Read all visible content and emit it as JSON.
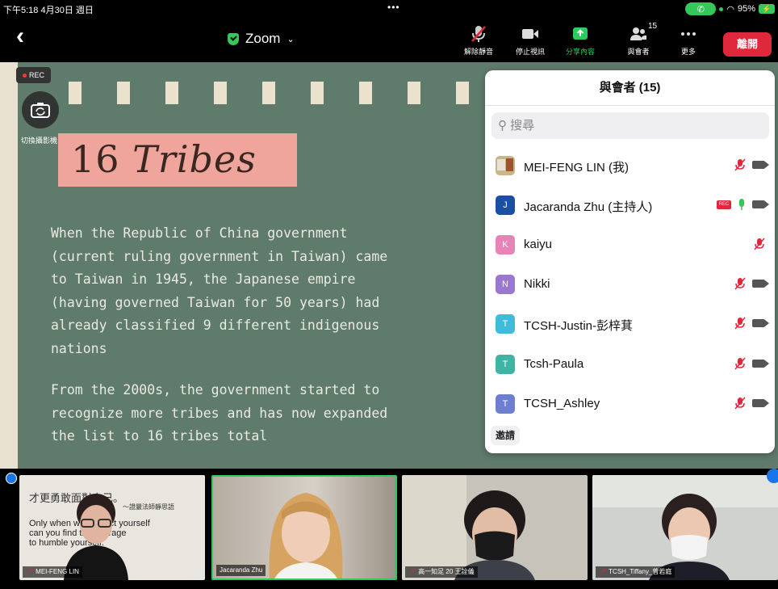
{
  "status_bar": {
    "time": "下午5:18  4月30日 週日",
    "dots": "•••",
    "battery": "95%"
  },
  "toolbar": {
    "title": "Zoom",
    "buttons": [
      {
        "label": "解除靜音",
        "icon": "muted-mic-icon"
      },
      {
        "label": "停止視訊",
        "icon": "video-camera-icon"
      },
      {
        "label": "分享內容",
        "icon": "share-screen-icon"
      },
      {
        "label": "與會者",
        "icon": "participants-icon",
        "badge": "15"
      },
      {
        "label": "更多",
        "icon": "more-icon"
      }
    ],
    "leave_label": "離開"
  },
  "rec_label": "REC",
  "camera_switch_label": "切換攝影機",
  "slide": {
    "title_number": "16",
    "title_word": "Tribes",
    "paragraph1": "When the Republic of China government\n(current ruling government in Taiwan) came\nto Taiwan in 1945, the Japanese empire\n(having governed Taiwan for 50 years) had\nalready classified 9 different indigenous\nnations",
    "paragraph2": "From the 2000s, the government started to\nrecognize more tribes and has now expanded\nthe list to 16 tribes total",
    "colors": {
      "background": "#5f7b6b",
      "title_band": "#efa59c"
    }
  },
  "participants_panel": {
    "title": "與會者 (15)",
    "search_placeholder": "搜尋",
    "invite_label": "邀請",
    "participants": [
      {
        "name": "MEI-FENG LIN (我)",
        "initial": "",
        "color": "#c8b58a",
        "mic": "muted",
        "video": true,
        "rec": false
      },
      {
        "name": "Jacaranda Zhu (主持人)",
        "initial": "J",
        "color": "#1b4fa3",
        "mic": "active",
        "video": true,
        "rec": true
      },
      {
        "name": "kaiyu",
        "initial": "K",
        "color": "#e884b5",
        "mic": "muted",
        "video": false,
        "rec": false
      },
      {
        "name": "Nikki",
        "initial": "N",
        "color": "#9b78cf",
        "mic": "muted",
        "video": true,
        "rec": false
      },
      {
        "name": "TCSH-Justin-彭梓萁",
        "initial": "T",
        "color": "#3fbcd8",
        "mic": "muted",
        "video": true,
        "rec": false
      },
      {
        "name": "Tcsh-Paula",
        "initial": "T",
        "color": "#3fb3a4",
        "mic": "muted",
        "video": true,
        "rec": false
      },
      {
        "name": "TCSH_Ashley",
        "initial": "T",
        "color": "#6f7fcf",
        "mic": "muted",
        "video": true,
        "rec": false
      }
    ]
  },
  "video_tiles": [
    {
      "name": "MEI-FENG LIN",
      "muted": true,
      "active": false
    },
    {
      "name": "Jacaranda Zhu",
      "muted": false,
      "active": true
    },
    {
      "name": "高一知足 20 王詮儀",
      "muted": true,
      "active": false
    },
    {
      "name": "TCSH_Tiffany_曾若庭",
      "muted": true,
      "active": false
    }
  ],
  "tile_texts": {
    "line1": "才更勇敢面對自己。",
    "line2": "～證嚴法師靜思語",
    "line3": "Only when we respect yourself",
    "line4": "can you find the courage",
    "line5": "to humble yourself."
  }
}
